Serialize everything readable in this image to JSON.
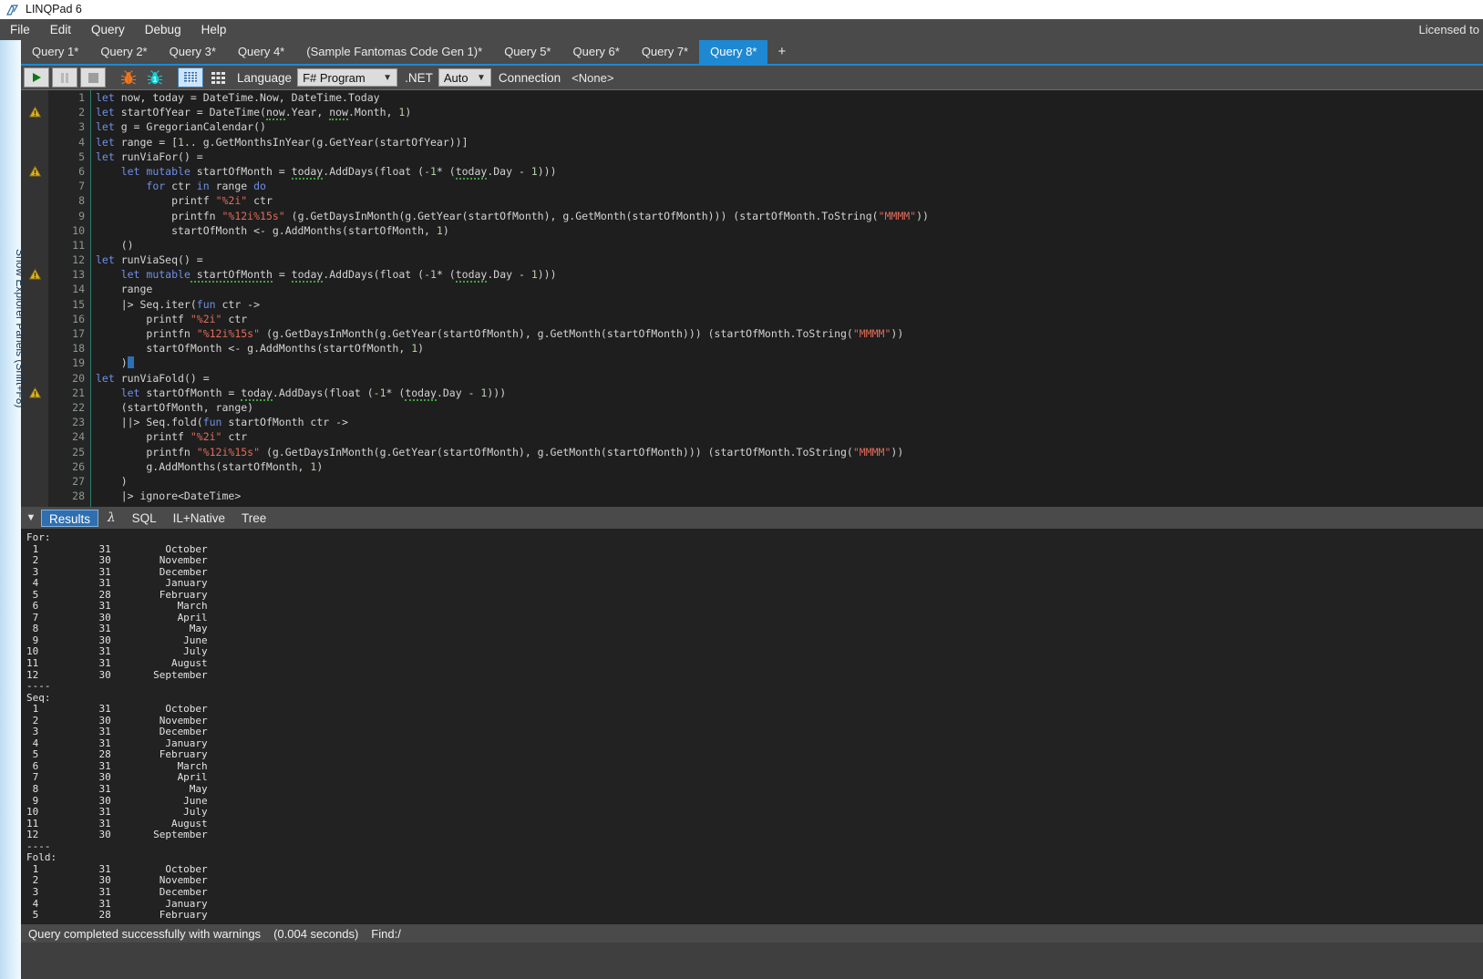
{
  "window": {
    "title": "LINQPad 6",
    "logo_icon": "linqpad-logo-icon",
    "licensed_to": "Licensed to"
  },
  "menu": {
    "items": [
      {
        "label": "File"
      },
      {
        "label": "Edit"
      },
      {
        "label": "Query"
      },
      {
        "label": "Debug"
      },
      {
        "label": "Help"
      }
    ]
  },
  "tabs": {
    "items": [
      {
        "label": "Query 1*",
        "active": false
      },
      {
        "label": "Query 2*",
        "active": false
      },
      {
        "label": "Query 3*",
        "active": false
      },
      {
        "label": "Query 4*",
        "active": false
      },
      {
        "label": "(Sample Fantomas Code Gen 1)*",
        "active": false
      },
      {
        "label": "Query 5*",
        "active": false
      },
      {
        "label": "Query 6*",
        "active": false
      },
      {
        "label": "Query 7*",
        "active": false
      },
      {
        "label": "Query 8*",
        "active": true
      }
    ],
    "add_label": "+"
  },
  "toolbar": {
    "run_icon": "play-icon",
    "pause_icon": "pause-icon",
    "stop_icon": "stop-icon",
    "debug_icon": "bug-icon",
    "debug_attach_icon": "bug-one-icon",
    "grid_results_icon": "results-grid-icon",
    "table_results_icon": "table-grid-icon",
    "language_label": "Language",
    "language_value": "F# Program",
    "net_label": ".NET",
    "net_value": "Auto",
    "connection_label": "Connection",
    "connection_value": "<None>"
  },
  "editor": {
    "warning_lines": [
      2,
      6,
      13,
      21
    ],
    "caret_line": 19,
    "lines": [
      {
        "n": 1,
        "tokens": [
          {
            "t": "let",
            "c": "kw"
          },
          {
            "t": " now, today = DateTime.Now, DateTime.Today",
            "c": "pln"
          }
        ]
      },
      {
        "n": 2,
        "tokens": [
          {
            "t": "let",
            "c": "kw"
          },
          {
            "t": " startOfYear = DateTime(",
            "c": "pln"
          },
          {
            "t": "now",
            "c": "sq"
          },
          {
            "t": ".Year, ",
            "c": "pln"
          },
          {
            "t": "now",
            "c": "sq"
          },
          {
            "t": ".Month, ",
            "c": "pln"
          },
          {
            "t": "1",
            "c": "num"
          },
          {
            "t": ")",
            "c": "pln"
          }
        ]
      },
      {
        "n": 3,
        "tokens": [
          {
            "t": "let",
            "c": "kw"
          },
          {
            "t": " g = GregorianCalendar()",
            "c": "pln"
          }
        ]
      },
      {
        "n": 4,
        "tokens": [
          {
            "t": "let",
            "c": "kw"
          },
          {
            "t": " range = [",
            "c": "pln"
          },
          {
            "t": "1",
            "c": "num"
          },
          {
            "t": ".. g.GetMonthsInYear(g.GetYear(startOfYear))]",
            "c": "pln"
          }
        ]
      },
      {
        "n": 5,
        "tokens": [
          {
            "t": "let",
            "c": "kw"
          },
          {
            "t": " runViaFor() =",
            "c": "pln"
          }
        ]
      },
      {
        "n": 6,
        "tokens": [
          {
            "t": "    ",
            "c": "pln"
          },
          {
            "t": "let mutable",
            "c": "kw"
          },
          {
            "t": " startOfMonth = ",
            "c": "pln"
          },
          {
            "t": "today",
            "c": "sq"
          },
          {
            "t": ".AddDays(float (",
            "c": "pln"
          },
          {
            "t": "-1",
            "c": "num"
          },
          {
            "t": "* (",
            "c": "pln"
          },
          {
            "t": "today",
            "c": "sq"
          },
          {
            "t": ".Day - ",
            "c": "pln"
          },
          {
            "t": "1",
            "c": "num"
          },
          {
            "t": ")))",
            "c": "pln"
          }
        ]
      },
      {
        "n": 7,
        "tokens": [
          {
            "t": "        ",
            "c": "pln"
          },
          {
            "t": "for",
            "c": "kw"
          },
          {
            "t": " ctr ",
            "c": "pln"
          },
          {
            "t": "in",
            "c": "kw"
          },
          {
            "t": " range ",
            "c": "pln"
          },
          {
            "t": "do",
            "c": "kw"
          }
        ]
      },
      {
        "n": 8,
        "tokens": [
          {
            "t": "            printf ",
            "c": "pln"
          },
          {
            "t": "\"%2i\"",
            "c": "str"
          },
          {
            "t": " ctr",
            "c": "pln"
          }
        ]
      },
      {
        "n": 9,
        "tokens": [
          {
            "t": "            printfn ",
            "c": "pln"
          },
          {
            "t": "\"%12i%15s\"",
            "c": "str"
          },
          {
            "t": " (g.GetDaysInMonth(g.GetYear(startOfMonth), g.GetMonth(startOfMonth))) (startOfMonth.ToString(",
            "c": "pln"
          },
          {
            "t": "\"MMMM\"",
            "c": "str"
          },
          {
            "t": "))",
            "c": "pln"
          }
        ]
      },
      {
        "n": 10,
        "tokens": [
          {
            "t": "            startOfMonth <- g.AddMonths(startOfMonth, ",
            "c": "pln"
          },
          {
            "t": "1",
            "c": "num"
          },
          {
            "t": ")",
            "c": "pln"
          }
        ]
      },
      {
        "n": 11,
        "tokens": [
          {
            "t": "    ()",
            "c": "pln"
          }
        ]
      },
      {
        "n": 12,
        "tokens": [
          {
            "t": "let",
            "c": "kw"
          },
          {
            "t": " runViaSeq() =",
            "c": "pln"
          }
        ]
      },
      {
        "n": 13,
        "tokens": [
          {
            "t": "    ",
            "c": "pln"
          },
          {
            "t": "let mutable",
            "c": "kw"
          },
          {
            "t": " startOfMonth",
            "c": "sq"
          },
          {
            "t": " = ",
            "c": "pln"
          },
          {
            "t": "today",
            "c": "sq"
          },
          {
            "t": ".AddDays(float (",
            "c": "pln"
          },
          {
            "t": "-1",
            "c": "num"
          },
          {
            "t": "* (",
            "c": "pln"
          },
          {
            "t": "today",
            "c": "sq"
          },
          {
            "t": ".Day - ",
            "c": "pln"
          },
          {
            "t": "1",
            "c": "num"
          },
          {
            "t": ")))",
            "c": "pln"
          }
        ]
      },
      {
        "n": 14,
        "tokens": [
          {
            "t": "    range",
            "c": "pln"
          }
        ]
      },
      {
        "n": 15,
        "tokens": [
          {
            "t": "    |> Seq.iter(",
            "c": "pln"
          },
          {
            "t": "fun",
            "c": "kw"
          },
          {
            "t": " ctr ->",
            "c": "pln"
          }
        ]
      },
      {
        "n": 16,
        "tokens": [
          {
            "t": "        printf ",
            "c": "pln"
          },
          {
            "t": "\"%2i\"",
            "c": "str"
          },
          {
            "t": " ctr",
            "c": "pln"
          }
        ]
      },
      {
        "n": 17,
        "tokens": [
          {
            "t": "        printfn ",
            "c": "pln"
          },
          {
            "t": "\"%12i%15s\"",
            "c": "str"
          },
          {
            "t": " (g.GetDaysInMonth(g.GetYear(startOfMonth), g.GetMonth(startOfMonth))) (startOfMonth.ToString(",
            "c": "pln"
          },
          {
            "t": "\"MMMM\"",
            "c": "str"
          },
          {
            "t": "))",
            "c": "pln"
          }
        ]
      },
      {
        "n": 18,
        "tokens": [
          {
            "t": "        startOfMonth <- g.AddMonths(startOfMonth, ",
            "c": "pln"
          },
          {
            "t": "1",
            "c": "num"
          },
          {
            "t": ")",
            "c": "pln"
          }
        ]
      },
      {
        "n": 19,
        "tokens": [
          {
            "t": "    )",
            "c": "pln"
          }
        ]
      },
      {
        "n": 20,
        "tokens": [
          {
            "t": "let",
            "c": "kw"
          },
          {
            "t": " runViaFold() =",
            "c": "pln"
          }
        ]
      },
      {
        "n": 21,
        "tokens": [
          {
            "t": "    ",
            "c": "pln"
          },
          {
            "t": "let",
            "c": "kw"
          },
          {
            "t": " startOfMonth = ",
            "c": "pln"
          },
          {
            "t": "today",
            "c": "sq"
          },
          {
            "t": ".AddDays(float (",
            "c": "pln"
          },
          {
            "t": "-1",
            "c": "num"
          },
          {
            "t": "* (",
            "c": "pln"
          },
          {
            "t": "today",
            "c": "sq"
          },
          {
            "t": ".Day - ",
            "c": "pln"
          },
          {
            "t": "1",
            "c": "num"
          },
          {
            "t": ")))",
            "c": "pln"
          }
        ]
      },
      {
        "n": 22,
        "tokens": [
          {
            "t": "    (startOfMonth, range)",
            "c": "pln"
          }
        ]
      },
      {
        "n": 23,
        "tokens": [
          {
            "t": "    ||> Seq.fold(",
            "c": "pln"
          },
          {
            "t": "fun",
            "c": "kw"
          },
          {
            "t": " startOfMonth ctr ->",
            "c": "pln"
          }
        ]
      },
      {
        "n": 24,
        "tokens": [
          {
            "t": "        printf ",
            "c": "pln"
          },
          {
            "t": "\"%2i\"",
            "c": "str"
          },
          {
            "t": " ctr",
            "c": "pln"
          }
        ]
      },
      {
        "n": 25,
        "tokens": [
          {
            "t": "        printfn ",
            "c": "pln"
          },
          {
            "t": "\"%12i%15s\"",
            "c": "str"
          },
          {
            "t": " (g.GetDaysInMonth(g.GetYear(startOfMonth), g.GetMonth(startOfMonth))) (startOfMonth.ToString(",
            "c": "pln"
          },
          {
            "t": "\"MMMM\"",
            "c": "str"
          },
          {
            "t": "))",
            "c": "pln"
          }
        ]
      },
      {
        "n": 26,
        "tokens": [
          {
            "t": "        g.AddMonths(startOfMonth, ",
            "c": "pln"
          },
          {
            "t": "1",
            "c": "num"
          },
          {
            "t": ")",
            "c": "pln"
          }
        ]
      },
      {
        "n": 27,
        "tokens": [
          {
            "t": "    )",
            "c": "pln"
          }
        ]
      },
      {
        "n": 28,
        "tokens": [
          {
            "t": "    |> ignore<DateTime>",
            "c": "pln"
          }
        ]
      }
    ]
  },
  "results": {
    "collapse_icon": "triangle-down-icon",
    "tabs": [
      {
        "label": "Results",
        "active": true
      },
      {
        "label": "λ",
        "active": false
      },
      {
        "label": "SQL",
        "active": false
      },
      {
        "label": "IL+Native",
        "active": false
      },
      {
        "label": "Tree",
        "active": false
      }
    ],
    "output_lines": [
      "For:",
      " 1          31         October",
      " 2          30        November",
      " 3          31        December",
      " 4          31         January",
      " 5          28        February",
      " 6          31           March",
      " 7          30           April",
      " 8          31             May",
      " 9          30            June",
      "10          31            July",
      "11          31          August",
      "12          30       September",
      "----",
      "Seq:",
      " 1          31         October",
      " 2          30        November",
      " 3          31        December",
      " 4          31         January",
      " 5          28        February",
      " 6          31           March",
      " 7          30           April",
      " 8          31             May",
      " 9          30            June",
      "10          31            July",
      "11          31          August",
      "12          30       September",
      "----",
      "Fold:",
      " 1          31         October",
      " 2          30        November",
      " 3          31        December",
      " 4          31         January",
      " 5          28        February"
    ]
  },
  "statusbar": {
    "message": "Query completed successfully with warnings",
    "elapsed": "(0.004 seconds)",
    "find": "Find:/"
  },
  "explorer_rail": {
    "label": "Show Explorer Panels (Shift+F8)"
  },
  "colors": {
    "accent": "#1e88d2",
    "editor_bg": "#1e1e1e",
    "output_bg": "#222222",
    "chrome": "#4a4a4a",
    "warning": "#d8b32a"
  }
}
